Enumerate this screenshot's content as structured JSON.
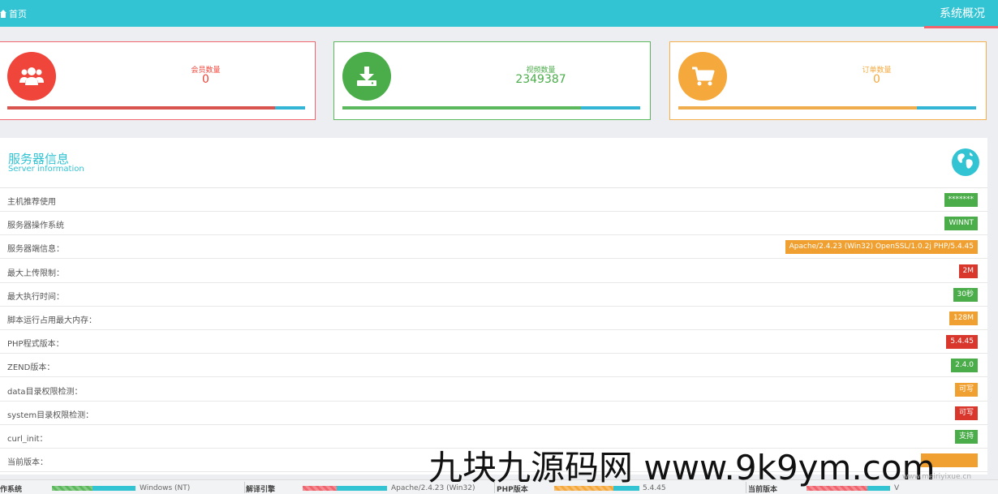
{
  "topbar": {
    "home_label": "首页",
    "page_title": "系统概况",
    "accent": "#33c4d4"
  },
  "cards": [
    {
      "label": "会员数量",
      "value": "0",
      "color": "#f0453a",
      "icon": "users-icon"
    },
    {
      "label": "视频数量",
      "value": "2349387",
      "color": "#4aad4a",
      "icon": "download-icon"
    },
    {
      "label": "订单数量",
      "value": "0",
      "color": "#f5a93d",
      "icon": "cart-icon"
    }
  ],
  "server": {
    "title": "服务器信息",
    "subtitle": "Server information",
    "rows": [
      {
        "label": "主机推荐使用",
        "value": "*******",
        "color": "#4aad4a"
      },
      {
        "label": "服务器操作系统",
        "value": "WINNT",
        "color": "#4aad4a"
      },
      {
        "label": "服务器端信息：",
        "value": "Apache/2.4.23 (Win32) OpenSSL/1.0.2j PHP/5.4.45",
        "color": "#f0a030"
      },
      {
        "label": "最大上传限制：",
        "value": "2M",
        "color": "#d9362c"
      },
      {
        "label": "最大执行时间：",
        "value": "30秒",
        "color": "#4aad4a"
      },
      {
        "label": "脚本运行占用最大内存：",
        "value": "128M",
        "color": "#f0a030"
      },
      {
        "label": "PHP程式版本：",
        "value": "5.4.45",
        "color": "#d9362c"
      },
      {
        "label": "ZEND版本：",
        "value": "2.4.0",
        "color": "#4aad4a"
      },
      {
        "label": "data目录权限检测：",
        "value": "可写",
        "color": "#f0a030"
      },
      {
        "label": "system目录权限检测：",
        "value": "可写",
        "color": "#d9362c"
      },
      {
        "label": "curl_init：",
        "value": "支持",
        "color": "#4aad4a"
      },
      {
        "label": "当前版本：",
        "value": "",
        "color": "#f0a030"
      }
    ]
  },
  "footer": [
    {
      "label": "作系统",
      "value": "Windows (NT)",
      "color": "#5cb85c"
    },
    {
      "label": "解译引擎",
      "value": "Apache/2.4.23 (Win32)",
      "color": "#f0646d"
    },
    {
      "label": "PHP版本",
      "value": "5.4.45",
      "color": "#f5a93d"
    },
    {
      "label": "当前版本",
      "value": "V",
      "color": "#f0646d"
    }
  ],
  "watermark": {
    "text": "九块九源码网 www.9k9ym.com",
    "logo_text": "www.meiriyixue.cn"
  }
}
